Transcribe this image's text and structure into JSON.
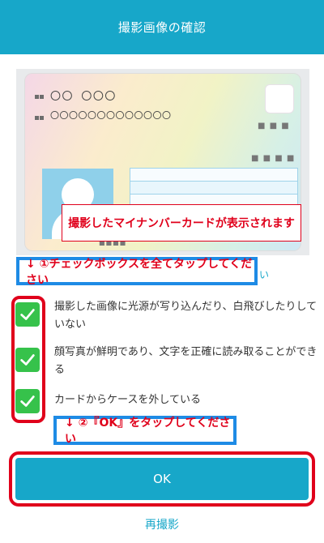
{
  "header": {
    "title": "撮影画像の確認"
  },
  "card": {
    "line1": "〇〇  〇〇〇",
    "line2": "〇〇〇〇〇〇〇〇〇〇〇〇〇",
    "caption": "撮影したマイナンバーカードが表示されます"
  },
  "guide1": {
    "text": "↓ ①チェックボックスを全てタップしてください"
  },
  "checklist": {
    "items": [
      {
        "label": "撮影した画像に光源が写り込んだり、白飛びしたりしていない",
        "checked": true
      },
      {
        "label": "顔写真が鮮明であり、文字を正確に読み取ることができる",
        "checked": true
      },
      {
        "label": "カードからケースを外している",
        "checked": true
      }
    ],
    "hidden_tail": "い"
  },
  "guide2": {
    "text": "↓ ②『OK』をタップしてください"
  },
  "ok_button": {
    "label": "OK"
  },
  "retake_link": {
    "label": "再撮影"
  },
  "colors": {
    "accent": "#17a7c9",
    "highlight_red": "#e0001b",
    "guide_blue": "#1e8be5",
    "check_green": "#36c24b"
  }
}
